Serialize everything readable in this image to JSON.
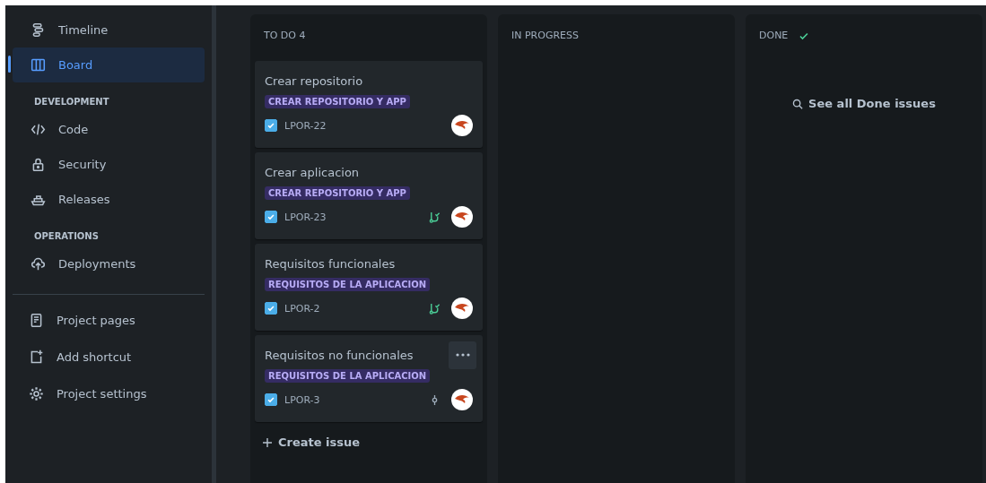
{
  "sidebar": {
    "groups": [
      {
        "items": [
          {
            "kind": "timeline",
            "label": "Timeline",
            "selected": false
          },
          {
            "kind": "board",
            "label": "Board",
            "selected": true
          }
        ]
      },
      {
        "heading": "DEVELOPMENT",
        "items": [
          {
            "kind": "code",
            "label": "Code",
            "selected": false
          },
          {
            "kind": "lock",
            "label": "Security",
            "selected": false
          },
          {
            "kind": "ship",
            "label": "Releases",
            "selected": false
          }
        ]
      },
      {
        "heading": "OPERATIONS",
        "items": [
          {
            "kind": "cloud",
            "label": "Deployments",
            "selected": false
          }
        ]
      }
    ],
    "footer_items": [
      {
        "kind": "page",
        "label": "Project pages"
      },
      {
        "kind": "shortcut",
        "label": "Add shortcut"
      },
      {
        "kind": "gear",
        "label": "Project settings"
      }
    ]
  },
  "board": {
    "columns": [
      {
        "title": "TO DO 4",
        "cards": [
          {
            "title": "Crear repositorio",
            "epic": "CREAR REPOSITORIO Y APP",
            "key": "LPOR-22",
            "checked": true,
            "kind": "plain",
            "more": false
          },
          {
            "title": "Crear aplicacion",
            "epic": "CREAR REPOSITORIO Y APP",
            "key": "LPOR-23",
            "checked": true,
            "kind": "branch",
            "more": false
          },
          {
            "title": "Requisitos funcionales",
            "epic": "REQUISITOS DE LA APLICACION",
            "key": "LPOR-2",
            "checked": true,
            "kind": "branch",
            "more": false
          },
          {
            "title": "Requisitos no funcionales",
            "epic": "REQUISITOS DE LA APLICACION",
            "key": "LPOR-3",
            "checked": true,
            "kind": "commit",
            "more": true
          }
        ],
        "create": "Create issue"
      },
      {
        "title": "IN PROGRESS"
      },
      {
        "title": "DONE",
        "done_check": true,
        "see_all": "See all Done issues"
      }
    ]
  }
}
